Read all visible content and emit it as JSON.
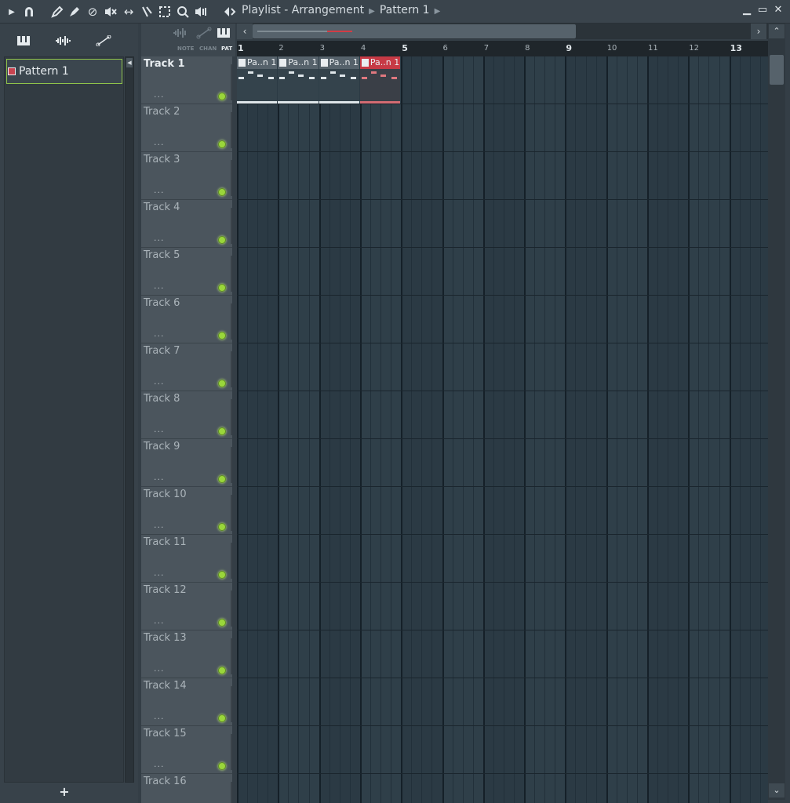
{
  "title": {
    "app": "Playlist - Arrangement",
    "pattern": "Pattern 1"
  },
  "picker": {
    "items": [
      {
        "label": "Pattern 1"
      }
    ],
    "add_label": "+"
  },
  "view_modes": [
    "NOTE",
    "CHAN",
    "PAT"
  ],
  "ruler": {
    "bars": [
      "1",
      "2",
      "3",
      "4",
      "5",
      "6",
      "7",
      "8",
      "9",
      "10",
      "11",
      "12",
      "13"
    ]
  },
  "tracks": [
    {
      "name": "Track 1"
    },
    {
      "name": "Track 2"
    },
    {
      "name": "Track 3"
    },
    {
      "name": "Track 4"
    },
    {
      "name": "Track 5"
    },
    {
      "name": "Track 6"
    },
    {
      "name": "Track 7"
    },
    {
      "name": "Track 8"
    },
    {
      "name": "Track 9"
    },
    {
      "name": "Track 10"
    },
    {
      "name": "Track 11"
    },
    {
      "name": "Track 12"
    },
    {
      "name": "Track 13"
    },
    {
      "name": "Track 14"
    },
    {
      "name": "Track 15"
    },
    {
      "name": "Track 16"
    }
  ],
  "track_menu_label": "...",
  "clips": [
    {
      "label": "Pa..n 1",
      "bar": 1,
      "selected": false
    },
    {
      "label": "Pa..n 1",
      "bar": 2,
      "selected": false
    },
    {
      "label": "Pa..n 1",
      "bar": 3,
      "selected": false
    },
    {
      "label": "Pa..n 1",
      "bar": 4,
      "selected": true
    }
  ],
  "colors": {
    "accent_green": "#9ad63b",
    "selected_clip": "#c63a45",
    "grid_bg": "#2b3a44"
  }
}
